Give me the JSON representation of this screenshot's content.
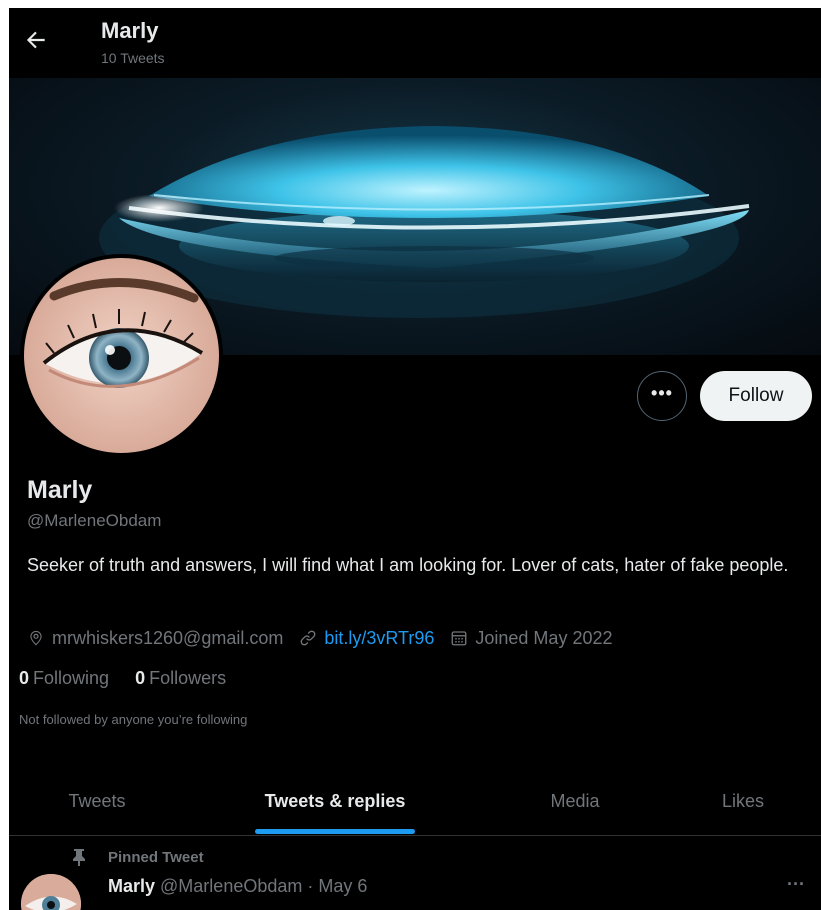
{
  "header": {
    "title": "Marly",
    "subtitle": "10 Tweets"
  },
  "profile": {
    "name": "Marly",
    "handle": "@MarleneObdam",
    "bio": "Seeker of truth and answers, I will find what I am looking for. Lover of cats, hater of fake people.",
    "location": "mrwhiskers1260@gmail.com",
    "website": "bit.ly/3vRTr96",
    "joined": "Joined May 2022",
    "following_count": "0",
    "following_label": "Following",
    "followers_count": "0",
    "followers_label": "Followers",
    "not_followed_text": "Not followed by anyone you’re following"
  },
  "actions": {
    "more_label": "•••",
    "follow_label": "Follow"
  },
  "tabs": [
    {
      "label": "Tweets",
      "active": false
    },
    {
      "label": "Tweets & replies",
      "active": true
    },
    {
      "label": "Media",
      "active": false
    },
    {
      "label": "Likes",
      "active": false
    }
  ],
  "pinned_tweet": {
    "pinned_label": "Pinned Tweet",
    "author_name": "Marly",
    "author_handle": "@MarleneObdam",
    "separator": "·",
    "date": "May 6",
    "more_label": "···"
  },
  "colors": {
    "background": "#000000",
    "primary_text": "#e7e9ea",
    "secondary_text": "#71767b",
    "accent": "#1d9bf0",
    "follow_button": "#eff3f4"
  },
  "icons": [
    "back-arrow-icon",
    "more-icon",
    "location-icon",
    "link-icon",
    "calendar-icon",
    "pin-icon"
  ]
}
